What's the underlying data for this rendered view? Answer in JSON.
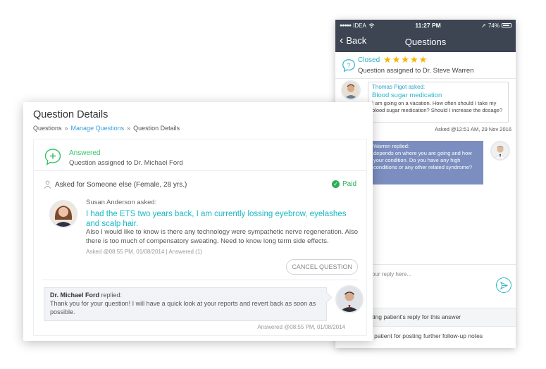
{
  "phone": {
    "status": {
      "carrier": "IDEA",
      "time": "11:27 PM",
      "battery": "74%"
    },
    "nav": {
      "back_label": "Back",
      "title": "Questions"
    },
    "header": {
      "status": "Closed",
      "stars": "★★★★★",
      "rating": 5,
      "assigned": "Question assigned to Dr. Steve Warren"
    },
    "question": {
      "asker": "Thomas Pigot asked:",
      "title": "Blood sugar medication",
      "text": "I am going on a vacation. How often should I take my blood sugar medication? Should I increase the dosage?",
      "asked_at": "Asked @12:51 AM, 29 Nov 2016"
    },
    "reply": {
      "name": "Warren replied:",
      "text": "depends on where you are going and how your condition. Do you have any high conditions or any other related syndrome?"
    },
    "input": {
      "placeholder": "your reply here..."
    },
    "options": [
      "sting patient's reply for this answer",
      "e patient for posting further follow-up notes"
    ]
  },
  "card": {
    "title": "Question Details",
    "breadcrumb": {
      "item1": "Questions",
      "sep": "»",
      "item2": "Manage Questions",
      "item3": "Question Details"
    },
    "status": {
      "label": "Answered",
      "assigned": "Question assigned to Dr. Michael Ford"
    },
    "asked_for": "Asked for Someone else (Female, 28 yrs.)",
    "paid_label": "Paid",
    "question": {
      "asker": "Susan Anderson asked:",
      "title": "I had the ETS two years back, I am currently lossing eyebrow, eyelashes and scalp hair.",
      "text": "Also I would like to know is there any technology were sympathetic nerve regeneration. Also there is too much of compensatory sweating. Need to know long term side effects.",
      "meta": "Asked @08:55 PM, 01/08/2014 | Answered (1)"
    },
    "cancel_label": "CANCEL QUESTION",
    "reply": {
      "doctor": "Dr. Michael Ford",
      "verb": " replied:",
      "text": "Thank you for your question! I will have a quick look at your reports and revert back as soon as possible.",
      "meta": "Answered @08:55 PM, 01/08/2014"
    }
  },
  "colors": {
    "teal": "#17b8c4",
    "green": "#34c36a",
    "nav_bg": "#3d4553",
    "star": "#f5b400",
    "reply_bubble": "#7b8ebf"
  },
  "icons": [
    "question-chat-icon",
    "add-chat-icon",
    "person-icon",
    "check-circle-icon",
    "send-icon",
    "back-chevron-icon",
    "wifi-icon",
    "location-icon"
  ]
}
